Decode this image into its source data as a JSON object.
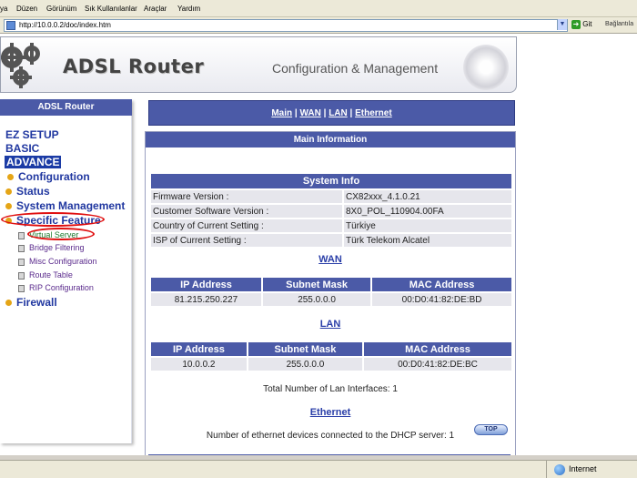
{
  "browser": {
    "menu": [
      "Dosya",
      "Düzen",
      "Görünüm",
      "Sık Kullanılanlar",
      "Araçlar",
      "Yardım"
    ],
    "menu_visible": [
      "ya",
      "Düzen",
      "Görünüm",
      "Sık Kullanılanlar",
      "Araçlar",
      "Yardım"
    ],
    "url": "http://10.0.0.2/doc/index.htm",
    "go_label": "Git",
    "links_label": "Bağlantıla",
    "status_zone": "Internet"
  },
  "banner": {
    "title": "ADSL Router",
    "subtitle": "Configuration & Management"
  },
  "nav": {
    "header": "ADSL Router",
    "top_items": [
      "EZ SETUP",
      "BASIC",
      "ADVANCE"
    ],
    "selected": "ADVANCE",
    "sections": [
      {
        "label": "Configuration"
      },
      {
        "label": "Status"
      },
      {
        "label": "System Management"
      },
      {
        "label": "Specific Feature",
        "children": [
          "Virtual Server",
          "Bridge Filtering",
          "Misc Configuration",
          "Route Table",
          "RIP Configuration"
        ]
      },
      {
        "label": "Firewall"
      }
    ]
  },
  "tabs": {
    "items": [
      "Main",
      "WAN",
      "LAN",
      "Ethernet"
    ],
    "separator": "|"
  },
  "main": {
    "title": "Main Information",
    "system_info": {
      "title": "System Info",
      "rows": [
        {
          "label": "Firmware Version :",
          "value": "CX82xxx_4.1.0.21"
        },
        {
          "label": "Customer Software Version :",
          "value": "8X0_POL_110904.00FA"
        },
        {
          "label": "Country of Current Setting :",
          "value": "Türkiye"
        },
        {
          "label": "ISP of Current Setting :",
          "value": "Türk Telekom Alcatel"
        }
      ]
    },
    "wan": {
      "title": "WAN",
      "headers": [
        "IP Address",
        "Subnet Mask",
        "MAC Address"
      ],
      "row": [
        "81.215.250.227",
        "255.0.0.0",
        "00:D0:41:82:DE:BD"
      ]
    },
    "lan": {
      "title": "LAN",
      "headers": [
        "IP Address",
        "Subnet Mask",
        "MAC Address"
      ],
      "row": [
        "10.0.0.2",
        "255.0.0.0",
        "00:D0:41:82:DE:BC"
      ],
      "interfaces_text": "Total Number of Lan Interfaces: 1"
    },
    "ethernet": {
      "title": "Ethernet",
      "devices_text": "Number of ethernet devices connected to the DHCP server: 1"
    },
    "top_button": "TOP"
  }
}
